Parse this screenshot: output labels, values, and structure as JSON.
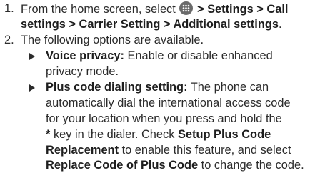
{
  "steps": [
    {
      "number": "1.",
      "line1_text": "From the home screen, select",
      "apps_icon": "apps-icon",
      "line1_path": "> Settings > Call",
      "line2_path": "settings > Carrier Setting > Additional settings",
      "line2_end": "."
    },
    {
      "number": "2.",
      "text": "The following options are available."
    }
  ],
  "options": [
    {
      "title": "Voice privacy:",
      "line1_rest": " Enable or disable enhanced",
      "line2": "privacy mode."
    },
    {
      "title": "Plus code dialing setting:",
      "line1_rest": " The phone can",
      "line2": "automatically dial the international access code",
      "line3": "for your location when you press and hold the",
      "line4_key": "*",
      "line4_rest": " key in the dialer. Check ",
      "line4_bold": "Setup Plus Code",
      "line5_bold": "Replacement",
      "line5_rest": " to enable this feature, and select",
      "line6_bold": "Replace Code of Plus Code",
      "line6_rest": " to change the code."
    }
  ],
  "bullet_icon": "triangle-bullet-icon"
}
